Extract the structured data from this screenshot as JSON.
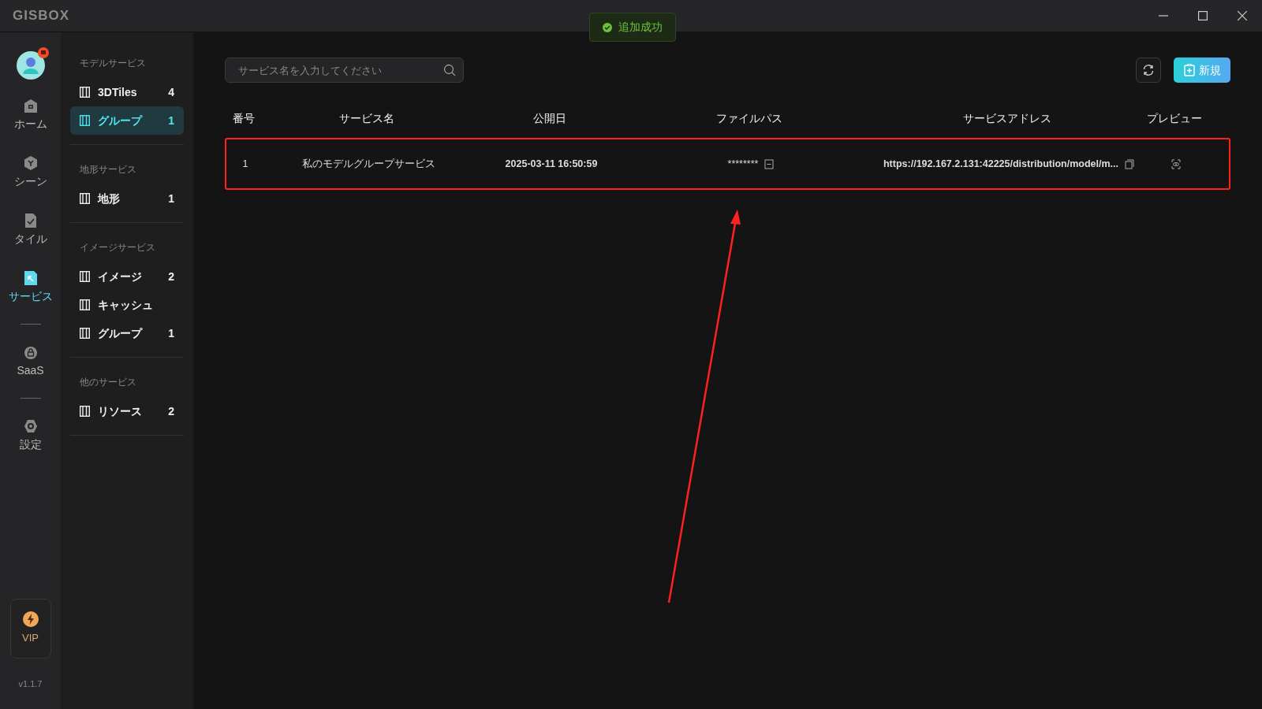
{
  "window": {
    "logo": "GISBOX"
  },
  "toast": {
    "message": "追加成功"
  },
  "nav_rail": {
    "items": [
      {
        "label": "ホーム",
        "kind": "home",
        "selected": false
      },
      {
        "label": "シーン",
        "kind": "scene",
        "selected": false
      },
      {
        "label": "タイル",
        "kind": "tile",
        "selected": false
      },
      {
        "label": "サービス",
        "kind": "service",
        "selected": true
      },
      {
        "label": "SaaS",
        "kind": "saas",
        "selected": false
      },
      {
        "label": "設定",
        "kind": "settings",
        "selected": false
      }
    ],
    "vip": "VIP",
    "version": "v1.1.7"
  },
  "sidebar": {
    "sections": [
      {
        "title": "モデルサービス",
        "items": [
          {
            "label": "3DTiles",
            "count": "4",
            "selected": false
          },
          {
            "label": "グループ",
            "count": "1",
            "selected": true
          }
        ]
      },
      {
        "title": "地形サービス",
        "items": [
          {
            "label": "地形",
            "count": "1",
            "selected": false
          }
        ]
      },
      {
        "title": "イメージサービス",
        "items": [
          {
            "label": "イメージ",
            "count": "2",
            "selected": false
          },
          {
            "label": "キャッシュ",
            "selected": false
          },
          {
            "label": "グループ",
            "count": "1",
            "selected": false
          }
        ]
      },
      {
        "title": "他のサービス",
        "items": [
          {
            "label": "リソース",
            "count": "2",
            "selected": false
          }
        ]
      }
    ]
  },
  "search": {
    "placeholder": "サービス名を入力してください"
  },
  "new_button": "新規",
  "table": {
    "columns": [
      "番号",
      "サービス名",
      "公開日",
      "ファイルパス",
      "サービスアドレス",
      "プレビュー"
    ],
    "rows": [
      {
        "number": "1",
        "name": "私のモデルグループサービス",
        "date": "2025-03-11 16:50:59",
        "file_path": "********",
        "address": "https://192.167.2.131:42225/distribution/model/m...",
        "highlighted": true
      }
    ]
  }
}
